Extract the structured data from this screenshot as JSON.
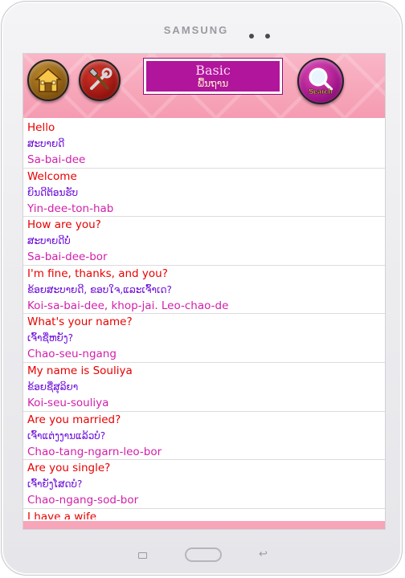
{
  "device": {
    "brand": "SAMSUNG"
  },
  "header": {
    "title_en": "Basic",
    "title_lo": "ພື້ນຖານ",
    "search_label": "Search",
    "colors": {
      "bg": "#f7a5b8",
      "title_bg": "#b0159c"
    }
  },
  "phrases": [
    {
      "en": "Hello",
      "lo": "ສະບາຍດີ",
      "rom": "Sa-bai-dee"
    },
    {
      "en": "Welcome",
      "lo": "ຍິນດີຕ້ອນຮັບ",
      "rom": "Yin-dee-ton-hab"
    },
    {
      "en": "How are you?",
      "lo": "ສະບາຍດີບໍ່",
      "rom": "Sa-bai-dee-bor"
    },
    {
      "en": "I'm fine, thanks, and you?",
      "lo": "ຂ້ອຍສະບາຍດີ, ຂອບໃຈ,ແລະເຈົ້າເດ?",
      "rom": "Koi-sa-bai-dee, khop-jai. Leo-chao-de"
    },
    {
      "en": "What's your name?",
      "lo": "ເຈົ້າຊື່ຫຍັງ?",
      "rom": "Chao-seu-ngang"
    },
    {
      "en": "My name is Souliya",
      "lo": "ຂ້ອຍຊື່ສຸລິຍາ",
      "rom": "Koi-seu-souliya"
    },
    {
      "en": "Are you married?",
      "lo": "ເຈົ້າແຕ່ງງານແລ້ວບໍ?",
      "rom": "Chao-tang-ngarn-leo-bor"
    },
    {
      "en": "Are you single?",
      "lo": "ເຈົ້າຍັງໂສດບໍ?",
      "rom": "Chao-ngang-sod-bor"
    },
    {
      "en": "I have a wife",
      "lo": "",
      "rom": ""
    }
  ],
  "colors": {
    "english": "#e80000",
    "lao": "#6a0bd8",
    "romanized": "#d11fa9"
  }
}
